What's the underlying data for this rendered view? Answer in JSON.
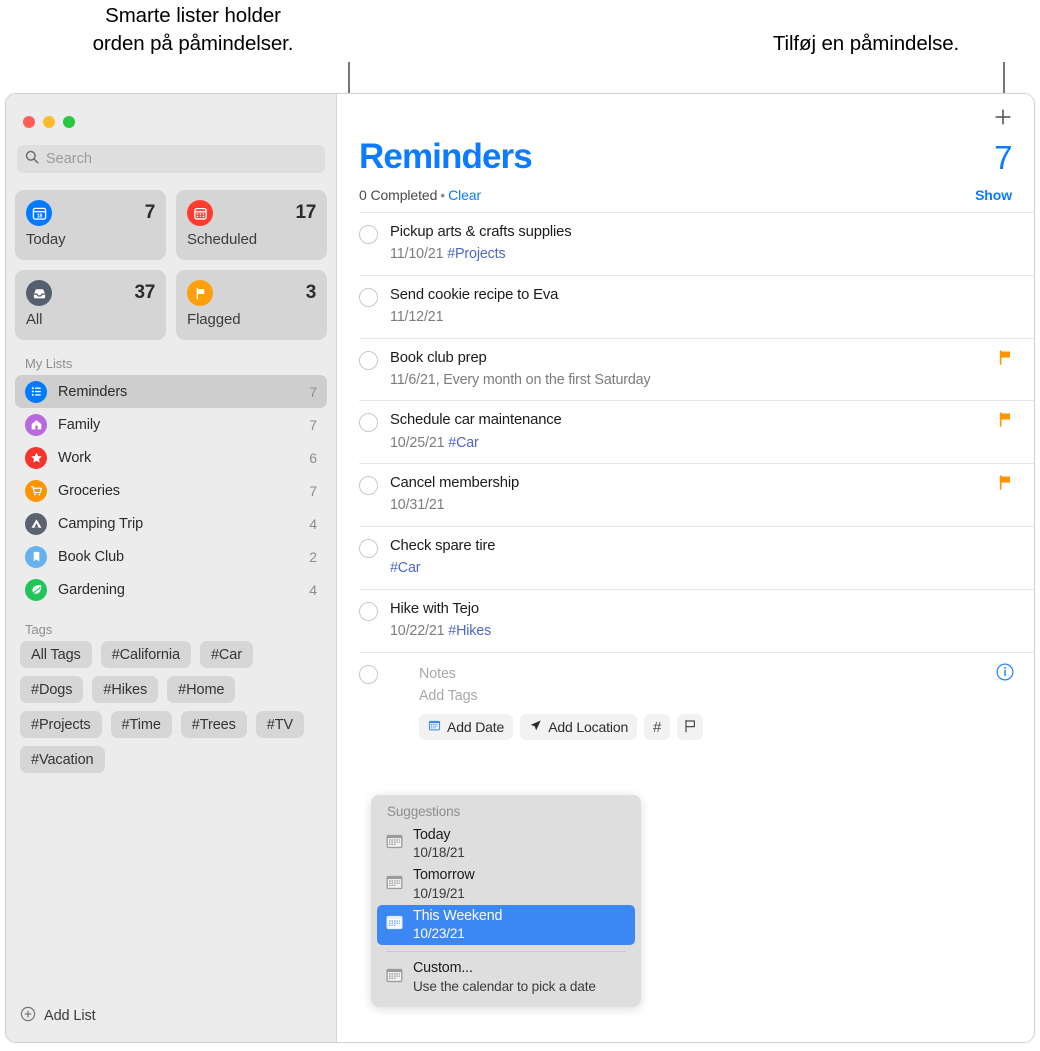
{
  "callouts": {
    "left": "Smarte lister holder\norden på påmindelser.",
    "right": "Tilføj en påmindelse."
  },
  "colors": {
    "accent_blue": "#0b7bff",
    "tag_blue": "#4e68c8",
    "flag_orange": "#ff9500",
    "selection_blue": "#3b87f3",
    "sidebar_bg": "#ececec"
  },
  "window": {
    "traffic_lights": [
      "close-red",
      "minimize-yellow",
      "zoom-green"
    ]
  },
  "sidebar": {
    "search": {
      "placeholder": "Search",
      "value": "",
      "icon": "search-icon"
    },
    "smart_lists": [
      {
        "label": "Today",
        "count": "7",
        "icon": "today-calendar-icon",
        "color": "#007aff"
      },
      {
        "label": "Scheduled",
        "count": "17",
        "icon": "scheduled-calendar-icon",
        "color": "#ff3b30"
      },
      {
        "label": "All",
        "count": "37",
        "icon": "all-inbox-icon",
        "color": "#55606e"
      },
      {
        "label": "Flagged",
        "count": "3",
        "icon": "flag-icon",
        "color": "#ff9f0a"
      }
    ],
    "my_lists_header": "My Lists",
    "my_lists": [
      {
        "name": "Reminders",
        "count": "7",
        "icon": "bullet-list-icon",
        "color": "#007aff",
        "selected": true
      },
      {
        "name": "Family",
        "count": "7",
        "icon": "home-icon",
        "color": "#b769dd",
        "selected": false
      },
      {
        "name": "Work",
        "count": "6",
        "icon": "star-icon",
        "color": "#f5342b",
        "selected": false
      },
      {
        "name": "Groceries",
        "count": "7",
        "icon": "cart-icon",
        "color": "#ff9500",
        "selected": false
      },
      {
        "name": "Camping Trip",
        "count": "4",
        "icon": "tent-icon",
        "color": "#5a6370",
        "selected": false
      },
      {
        "name": "Book Club",
        "count": "2",
        "icon": "bookmark-icon",
        "color": "#66b2ee",
        "selected": false
      },
      {
        "name": "Gardening",
        "count": "4",
        "icon": "leaf-icon",
        "color": "#22c55a",
        "selected": false
      }
    ],
    "tags_header": "Tags",
    "tags": [
      "All Tags",
      "#California",
      "#Car",
      "#Dogs",
      "#Hikes",
      "#Home",
      "#Projects",
      "#Time",
      "#Trees",
      "#TV",
      "#Vacation"
    ],
    "add_list": {
      "label": "Add List",
      "icon": "plus-circle-icon"
    }
  },
  "main": {
    "add_reminder_icon": "plus-icon",
    "title": "Reminders",
    "total": "7",
    "completed_text": "0 Completed",
    "separator": "•",
    "clear_label": "Clear",
    "show_label": "Show",
    "reminders": [
      {
        "title": "Pickup arts & crafts supplies",
        "date": "11/10/21",
        "tag": "#Projects",
        "flagged": false
      },
      {
        "title": "Send cookie recipe to Eva",
        "date": "11/12/21",
        "tag": "",
        "flagged": false
      },
      {
        "title": "Book club prep",
        "date": "11/6/21, Every month on the first Saturday",
        "tag": "",
        "flagged": true
      },
      {
        "title": "Schedule car maintenance",
        "date": "10/25/21",
        "tag": "#Car",
        "flagged": true
      },
      {
        "title": "Cancel membership",
        "date": "10/31/21",
        "tag": "",
        "flagged": true
      },
      {
        "title": "Check spare tire",
        "date": "",
        "tag": "#Car",
        "flagged": false
      },
      {
        "title": "Hike with Tejo",
        "date": "10/22/21",
        "tag": "#Hikes",
        "flagged": false
      }
    ],
    "editor": {
      "title_value": "",
      "notes_placeholder": "Notes",
      "tags_placeholder": "Add Tags",
      "add_date_label": "Add Date",
      "add_location_label": "Add Location",
      "hash_label": "#",
      "flag_label": "flag-outline-icon",
      "info_icon": "info-circle-icon"
    }
  },
  "suggestions": {
    "header": "Suggestions",
    "items": [
      {
        "title": "Today",
        "subtitle": "10/18/21",
        "selected": false
      },
      {
        "title": "Tomorrow",
        "subtitle": "10/19/21",
        "selected": false
      },
      {
        "title": "This Weekend",
        "subtitle": "10/23/21",
        "selected": true
      },
      {
        "title": "Custom...",
        "subtitle": "Use the calendar to pick a date",
        "selected": false
      }
    ]
  }
}
